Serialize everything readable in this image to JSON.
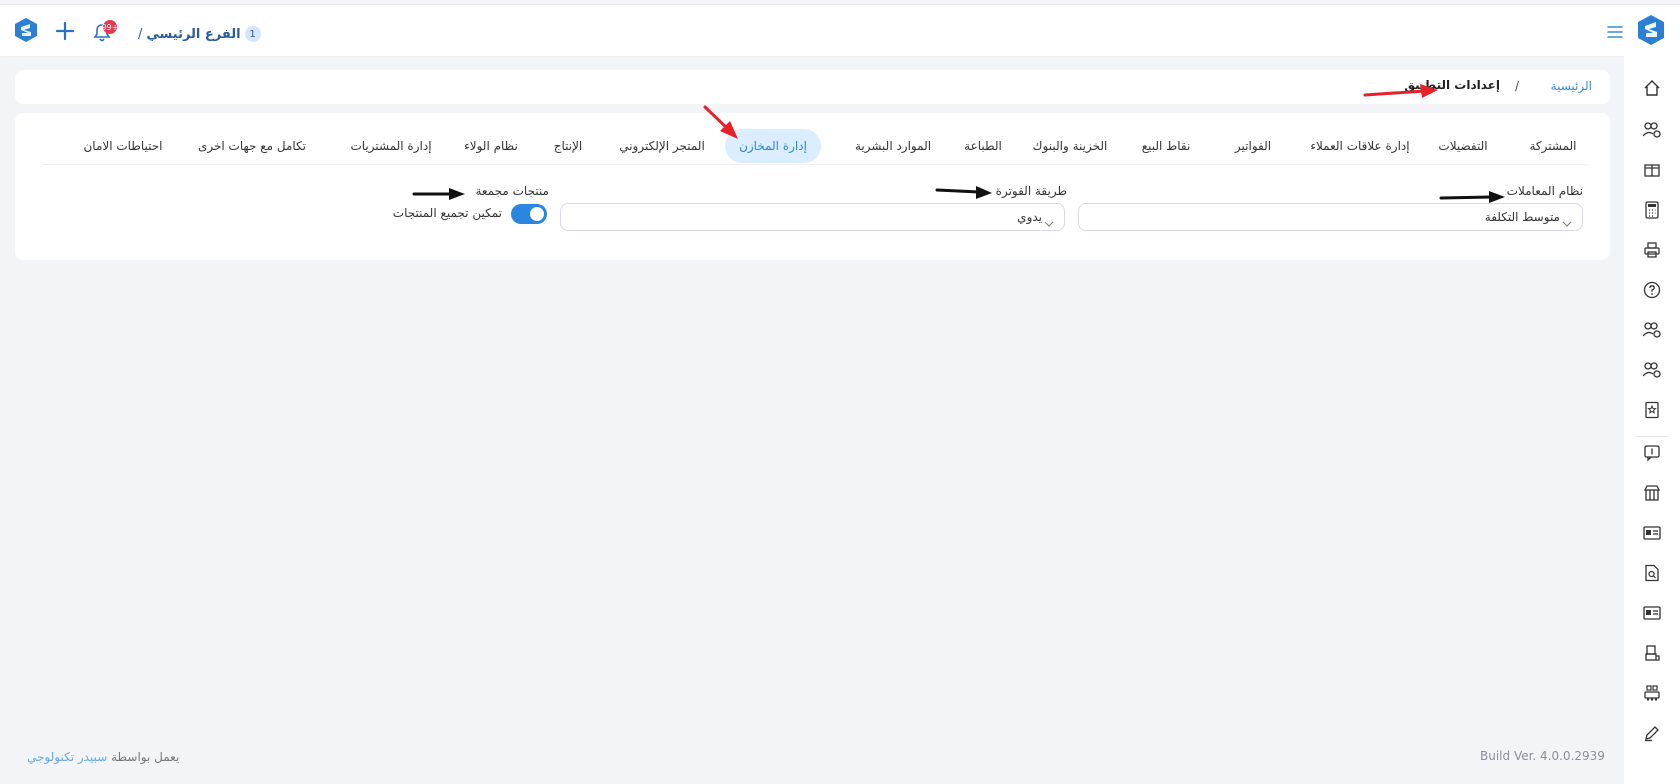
{
  "header": {
    "branch_number": "1",
    "branch_name": "الفرع الرئيسي",
    "branch_separator": "/",
    "notification_badge": "99+"
  },
  "breadcrumb": {
    "home": "الرئيسية",
    "separator": "/",
    "current": "إعدادات التطبيق"
  },
  "tabs": [
    {
      "label": "المشتركة"
    },
    {
      "label": "التفضيلات"
    },
    {
      "label": "إدارة علاقات العملاء"
    },
    {
      "label": "الفواتير"
    },
    {
      "label": "نقاط البيع"
    },
    {
      "label": "الخزينة والبنوك"
    },
    {
      "label": "الطباعة"
    },
    {
      "label": "الموارد البشرية"
    },
    {
      "label": "إدارة المخازن",
      "active": true
    },
    {
      "label": "المتجر الإلكتروني"
    },
    {
      "label": "الإنتاج"
    },
    {
      "label": "نظام الولاء"
    },
    {
      "label": "إدارة المشتريات"
    },
    {
      "label": "تكامل مع جهات اخرى"
    },
    {
      "label": "احتياطات الامان"
    }
  ],
  "form": {
    "transactions_system": {
      "label": "نظام المعاملات",
      "value": "متوسط التكلفة"
    },
    "invoice_method": {
      "label": "طريقة الفوترة",
      "value": "يدوي"
    },
    "bundled_products": {
      "label": "منتجات مجمعة",
      "toggle_label": "تمكين تجميع المنتجات",
      "enabled": true
    }
  },
  "footer": {
    "powered_by": "يعمل بواسطة",
    "company": "سبيدر تكنولوجي",
    "build_version": "Build Ver. 4.0.0.2939"
  },
  "sidebar": {
    "icons": [
      "home-icon",
      "users-gear-icon",
      "box-icon",
      "calculator-icon",
      "printer-icon",
      "help-icon",
      "users-gear-icon",
      "users-gear-icon",
      "book-star-icon",
      "chat-money-icon",
      "store-icon",
      "id-card-icon",
      "file-search-icon",
      "id-card-icon",
      "pos-icon",
      "factory-icon",
      "pen-icon"
    ]
  },
  "colors": {
    "accent": "#2b86e0",
    "tab_active_bg": "#dbeeff",
    "badge": "#e53950",
    "page_bg": "#f3f4f8",
    "annotation_red": "#e8202a",
    "annotation_black": "#111111"
  }
}
